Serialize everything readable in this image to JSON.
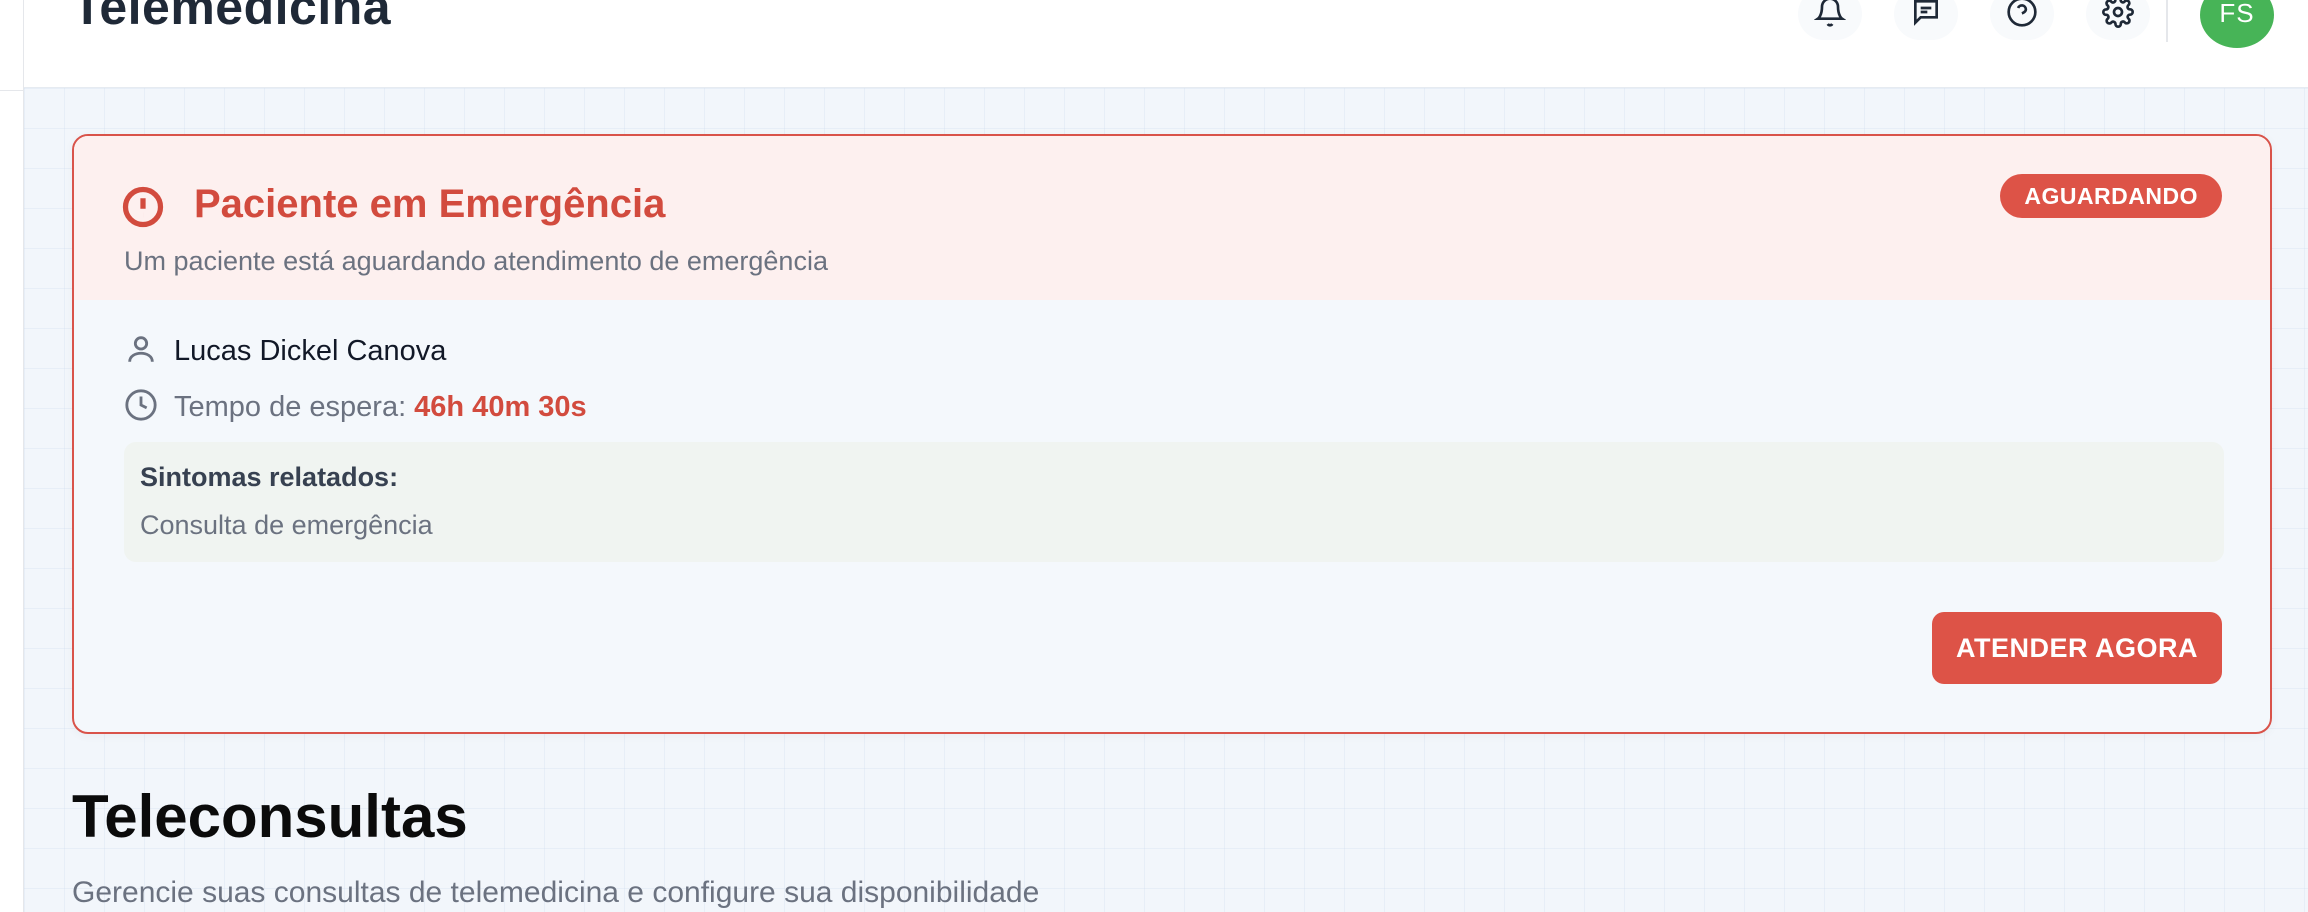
{
  "header": {
    "app_title": "Telemedicina",
    "icons": [
      "bell-icon",
      "message-icon",
      "help-icon",
      "gear-icon"
    ],
    "avatar_initials": "FS",
    "avatar_color": "#47b457"
  },
  "emergency": {
    "title": "Paciente em Emergência",
    "subtitle": "Um paciente está aguardando atendimento de emergência",
    "status": "AGUARDANDO",
    "patient_name": "Lucas Dickel Canova",
    "wait_label": "Tempo de espera:",
    "wait_value": "46h 40m 30s",
    "symptoms_label": "Sintomas relatados:",
    "symptoms_text": "Consulta de emergência",
    "action_label": "ATENDER AGORA",
    "accent_color": "#d24b3e"
  },
  "page": {
    "title": "Teleconsultas",
    "subtitle": "Gerencie suas consultas de telemedicina e configure sua disponibilidade"
  }
}
